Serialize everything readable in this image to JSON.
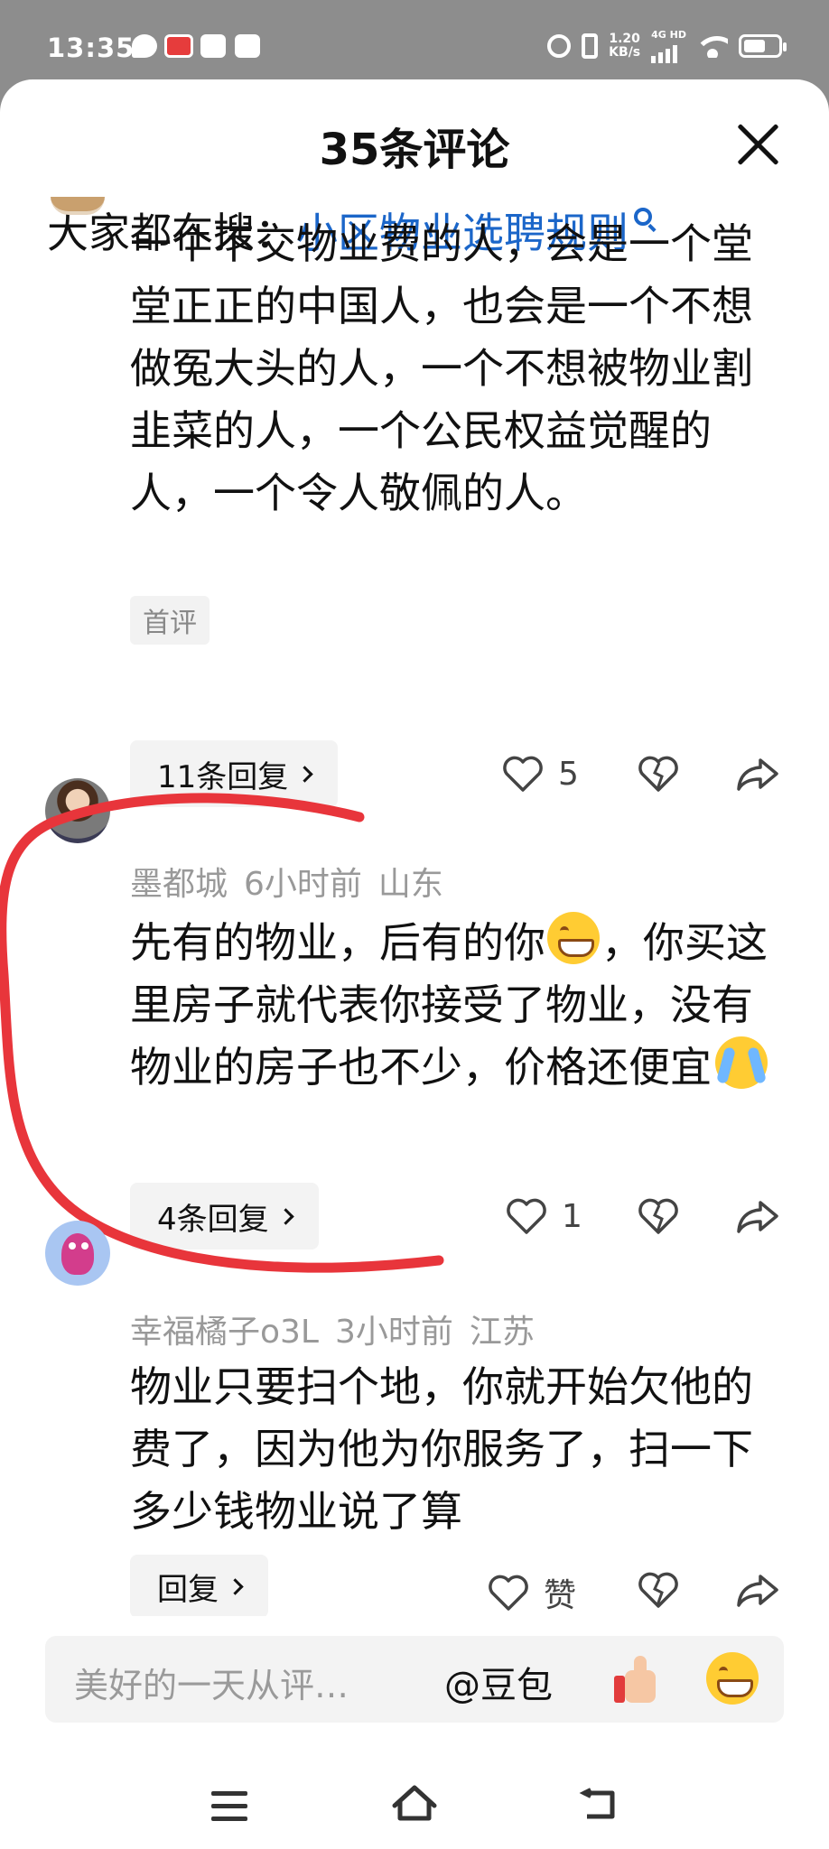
{
  "status_bar": {
    "time": "13:35",
    "net_speed": "1.20",
    "net_unit": "KB/s",
    "network": "4G HD",
    "notif_icons": [
      "chat-bubble-icon",
      "toutiao-icon",
      "package-icon",
      "vivo-icon"
    ]
  },
  "sheet": {
    "title": "35条评论",
    "hot_search_label": "大家都在搜：",
    "hot_search_query": "小区物业选聘规则"
  },
  "comments": [
    {
      "text": "一个不交物业费的人，会是一个堂堂正正的中国人，也会是一个不想做冤大头的人，一个不想被物业割韭菜的人，一个公民权益觉醒的人，一个令人敬佩的人。",
      "tag": "首评",
      "replies": "11条回复",
      "likes": "5"
    },
    {
      "author": "墨都城",
      "time": "6小时前",
      "location": "山东",
      "text_part1": "先有的物业，后有的你",
      "text_part2": "，你买这里房子就代表你接受了物业，没有物业的房子也不少，价格还便宜",
      "replies": "4条回复",
      "likes": "1"
    },
    {
      "author": "幸福橘子o3L",
      "time": "3小时前",
      "location": "江苏",
      "text": "物业只要扫个地，你就开始欠他的费了，因为他为你服务了，扫一下多少钱物业说了算",
      "replies": "回复",
      "likes": "赞"
    }
  ],
  "input_bar": {
    "placeholder": "美好的一天从评…",
    "mention": "@豆包"
  },
  "colors": {
    "accent_link": "#1b66c9",
    "annotation_red": "#e8353b",
    "statusbar_bg": "#8d8d8d"
  }
}
